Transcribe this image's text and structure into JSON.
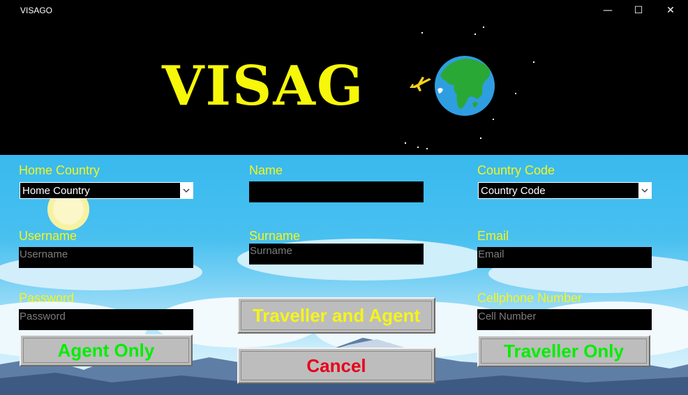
{
  "window": {
    "title": "VISAGO",
    "controls": {
      "minimize": "—",
      "maximize": "☐",
      "close": "✕"
    }
  },
  "banner": {
    "logo_text": "VISAG"
  },
  "form": {
    "home_country": {
      "label": "Home Country",
      "value": "Home Country"
    },
    "name": {
      "label": "Name",
      "value": ""
    },
    "country_code": {
      "label": "Country Code",
      "value": "Country Code"
    },
    "username": {
      "label": "Username",
      "placeholder": "Username"
    },
    "surname": {
      "label": "Surname",
      "placeholder": "Surname"
    },
    "email": {
      "label": "Email",
      "placeholder": "Email"
    },
    "password": {
      "label": "Password",
      "placeholder": "Password"
    },
    "cellphone": {
      "label": "Cellphone Number",
      "placeholder": "Cell Number"
    }
  },
  "buttons": {
    "agent_only": "Agent Only",
    "traveller_and_agent": "Traveller and Agent",
    "cancel": "Cancel",
    "traveller_only": "Traveller Only"
  },
  "colors": {
    "label": "#f5f51a",
    "logo": "#f7f70a",
    "agent_only_text": "#00ee00",
    "traveller_only_text": "#00ee00",
    "traveller_and_agent_text": "#f5f51a",
    "cancel_text": "#e8001a"
  },
  "icons": {
    "dropdown": "chevron-down-icon",
    "globe": "globe-icon",
    "airplane": "airplane-icon"
  }
}
